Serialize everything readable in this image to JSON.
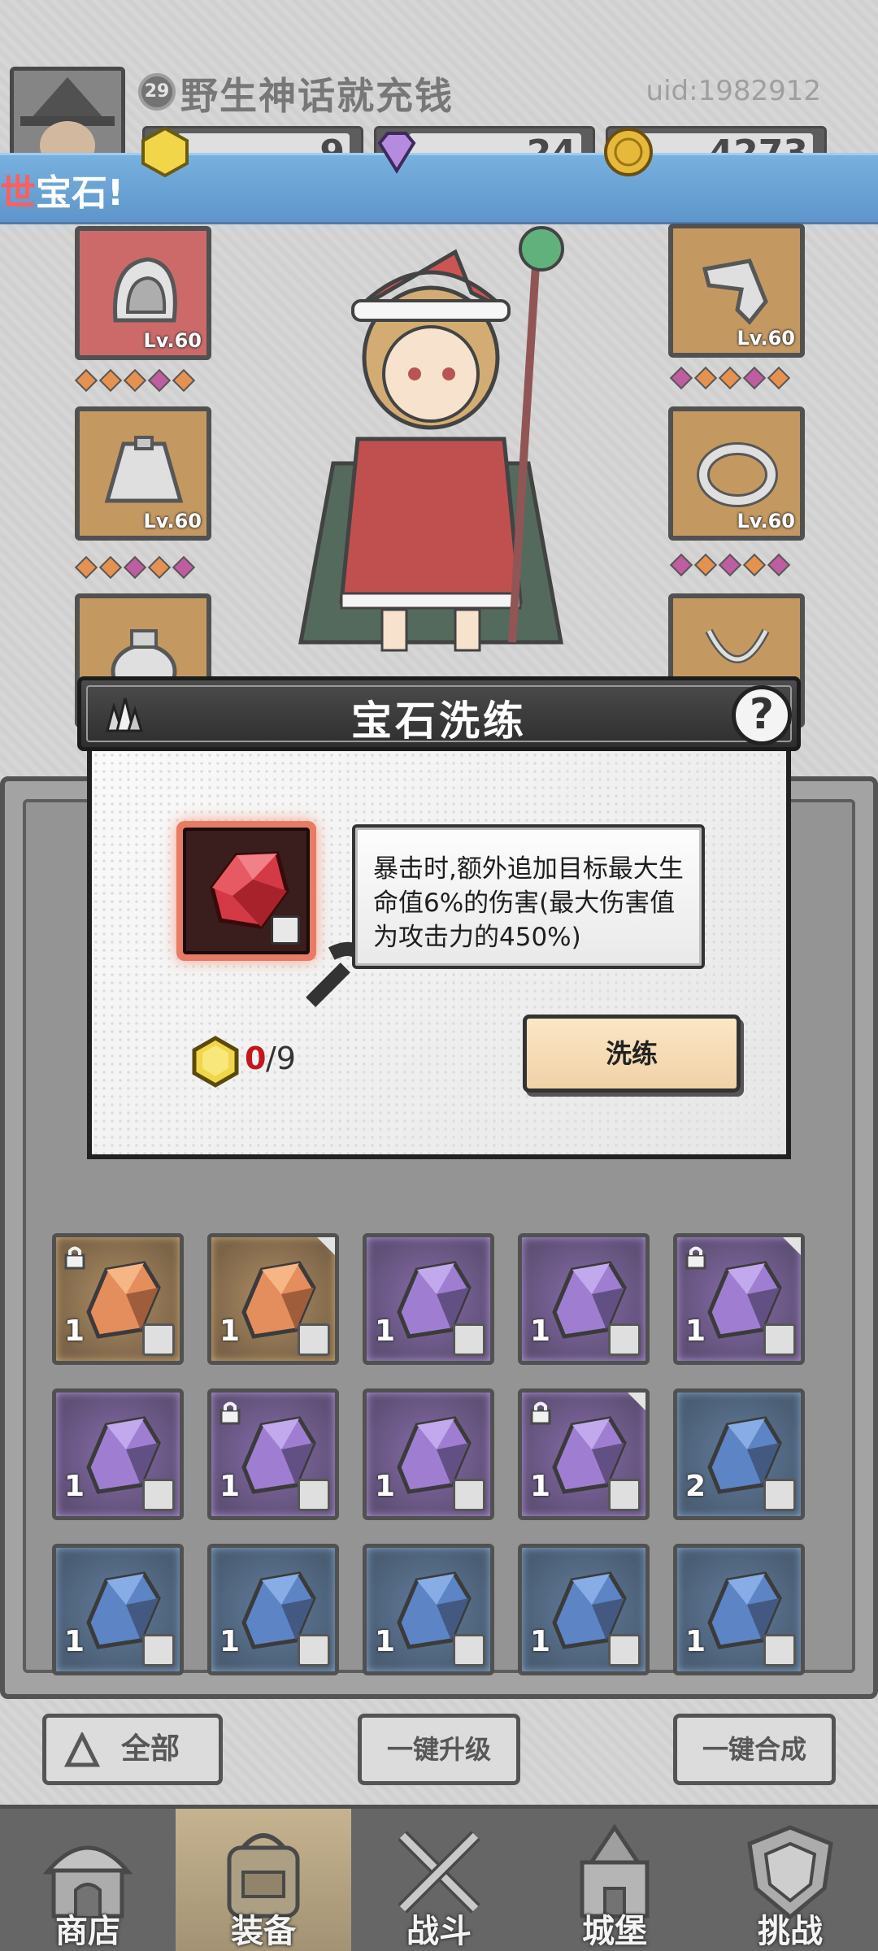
{
  "player": {
    "level": "29",
    "name": "野生神话就充钱",
    "uid": "uid:1982912"
  },
  "resources": {
    "gold_stone": "9",
    "diamond": "24",
    "coin": "4273"
  },
  "banner": {
    "prefix": "世",
    "text": "宝石!"
  },
  "equipment": {
    "left_top_level": "Lv.60",
    "left_mid_level": "Lv.60",
    "right_top_level": "Lv.60",
    "right_mid_level": "Lv.60"
  },
  "modal": {
    "title": "宝石洗练",
    "help": "?",
    "description": "暴击时,额外追加目标最大生命值6%的伤害(最大伤害值为攻击力的450%)",
    "cost_have": "0",
    "cost_need": "/9",
    "refine_button": "洗练"
  },
  "inventory": {
    "rows": [
      [
        {
          "rarity": "o",
          "count": "1",
          "locked": true,
          "corner": false
        },
        {
          "rarity": "o",
          "count": "1",
          "locked": false,
          "corner": true
        },
        {
          "rarity": "p",
          "count": "1",
          "locked": false,
          "corner": false
        },
        {
          "rarity": "p",
          "count": "1",
          "locked": false,
          "corner": false
        },
        {
          "rarity": "p",
          "count": "1",
          "locked": true,
          "corner": true
        }
      ],
      [
        {
          "rarity": "p",
          "count": "1",
          "locked": false,
          "corner": false
        },
        {
          "rarity": "p",
          "count": "1",
          "locked": true,
          "corner": false
        },
        {
          "rarity": "p",
          "count": "1",
          "locked": false,
          "corner": false
        },
        {
          "rarity": "p",
          "count": "1",
          "locked": true,
          "corner": true
        },
        {
          "rarity": "b",
          "count": "2",
          "locked": false,
          "corner": false
        }
      ],
      [
        {
          "rarity": "b",
          "count": "1",
          "locked": false,
          "corner": false
        },
        {
          "rarity": "b",
          "count": "1",
          "locked": false,
          "corner": false
        },
        {
          "rarity": "b",
          "count": "1",
          "locked": false,
          "corner": false
        },
        {
          "rarity": "b",
          "count": "1",
          "locked": false,
          "corner": false
        },
        {
          "rarity": "b",
          "count": "1",
          "locked": false,
          "corner": false
        }
      ]
    ]
  },
  "actions": {
    "filter": "全部",
    "upgrade_all": "一键升级",
    "merge_all": "一键合成"
  },
  "nav": {
    "shop": "商店",
    "equip": "装备",
    "battle": "战斗",
    "castle": "城堡",
    "challenge": "挑战"
  },
  "colors": {
    "accent_red": "#c4161c",
    "banner_blue": "#3b7fc0",
    "button_cream": "#f1d2a6"
  }
}
